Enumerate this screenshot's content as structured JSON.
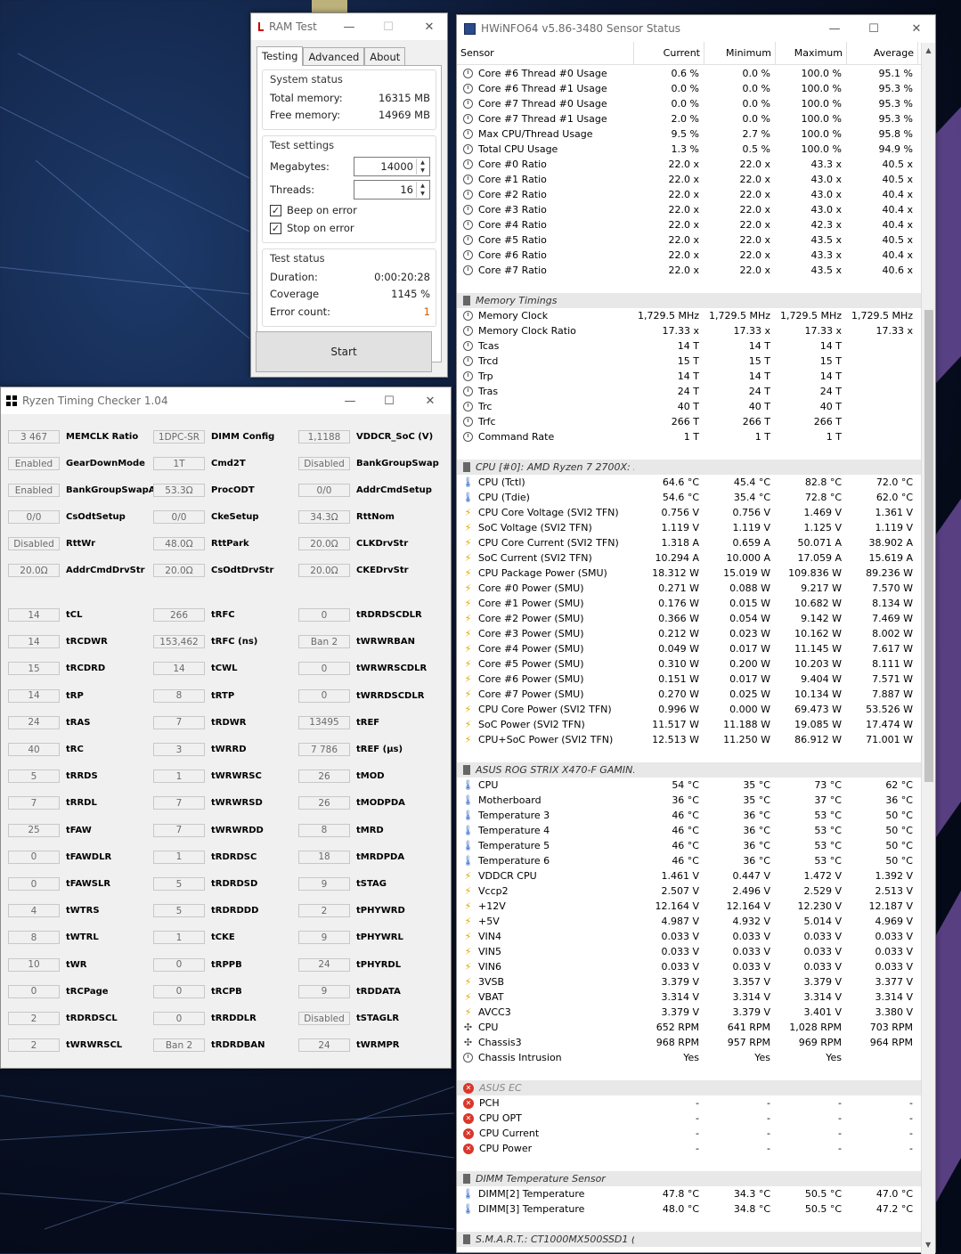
{
  "ram_test": {
    "title": "RAM Test",
    "tabs": [
      "Testing",
      "Advanced",
      "About"
    ],
    "system_status": {
      "title": "System status",
      "total_label": "Total memory:",
      "total_value": "16315 MB",
      "free_label": "Free memory:",
      "free_value": "14969 MB"
    },
    "test_settings": {
      "title": "Test settings",
      "megabytes_label": "Megabytes:",
      "megabytes_value": "14000",
      "threads_label": "Threads:",
      "threads_value": "16",
      "beep_label": "Beep on error",
      "stop_label": "Stop on error"
    },
    "test_status": {
      "title": "Test status",
      "duration_label": "Duration:",
      "duration_value": "0:00:20:28",
      "coverage_label": "Coverage",
      "coverage_value": "1145 %",
      "error_label": "Error count:",
      "error_value": "1"
    },
    "start_label": "Start"
  },
  "rtc": {
    "title": "Ryzen Timing Checker 1.04",
    "top": [
      [
        "3 467",
        "MEMCLK Ratio",
        "1DPC-SR",
        "DIMM Config",
        "1,1188",
        "VDDCR_SoC (V)"
      ],
      [
        "Enabled",
        "GearDownMode",
        "1T",
        "Cmd2T",
        "Disabled",
        "BankGroupSwap"
      ],
      [
        "Enabled",
        "BankGroupSwapAlt",
        "53.3Ω",
        "ProcODT",
        "0/0",
        "AddrCmdSetup"
      ],
      [
        "0/0",
        "CsOdtSetup",
        "0/0",
        "CkeSetup",
        "34.3Ω",
        "RttNom"
      ],
      [
        "Disabled",
        "RttWr",
        "48.0Ω",
        "RttPark",
        "20.0Ω",
        "CLKDrvStr"
      ],
      [
        "20.0Ω",
        "AddrCmdDrvStr",
        "20.0Ω",
        "CsOdtDrvStr",
        "20.0Ω",
        "CKEDrvStr"
      ]
    ],
    "bottom": [
      [
        "14",
        "tCL",
        "266",
        "tRFC",
        "0",
        "tRDRDSCDLR"
      ],
      [
        "14",
        "tRCDWR",
        "153,462",
        "tRFC (ns)",
        "Ban 2",
        "tWRWRBAN"
      ],
      [
        "15",
        "tRCDRD",
        "14",
        "tCWL",
        "0",
        "tWRWRSCDLR"
      ],
      [
        "14",
        "tRP",
        "8",
        "tRTP",
        "0",
        "tWRRDSCDLR"
      ],
      [
        "24",
        "tRAS",
        "7",
        "tRDWR",
        "13495",
        "tREF"
      ],
      [
        "40",
        "tRC",
        "3",
        "tWRRD",
        "7 786",
        "tREF (µs)"
      ],
      [
        "5",
        "tRRDS",
        "1",
        "tWRWRSC",
        "26",
        "tMOD"
      ],
      [
        "7",
        "tRRDL",
        "7",
        "tWRWRSD",
        "26",
        "tMODPDA"
      ],
      [
        "25",
        "tFAW",
        "7",
        "tWRWRDD",
        "8",
        "tMRD"
      ],
      [
        "0",
        "tFAWDLR",
        "1",
        "tRDRDSC",
        "18",
        "tMRDPDA"
      ],
      [
        "0",
        "tFAWSLR",
        "5",
        "tRDRDSD",
        "9",
        "tSTAG"
      ],
      [
        "4",
        "tWTRS",
        "5",
        "tRDRDDD",
        "2",
        "tPHYWRD"
      ],
      [
        "8",
        "tWTRL",
        "1",
        "tCKE",
        "9",
        "tPHYWRL"
      ],
      [
        "10",
        "tWR",
        "0",
        "tRPPB",
        "24",
        "tPHYRDL"
      ],
      [
        "0",
        "tRCPage",
        "0",
        "tRCPB",
        "9",
        "tRDDATA"
      ],
      [
        "2",
        "tRDRDSCL",
        "0",
        "tRRDDLR",
        "Disabled",
        "tSTAGLR"
      ],
      [
        "2",
        "tWRWRSCL",
        "Ban 2",
        "tRDRDBAN",
        "24",
        "tWRMPR"
      ]
    ]
  },
  "hwinfo": {
    "title": "HWiNFO64 v5.86-3480 Sensor Status",
    "headers": [
      "Sensor",
      "Current",
      "Minimum",
      "Maximum",
      "Average"
    ],
    "rows": [
      [
        "clock",
        "Core #6 Thread #0 Usage",
        "0.6 %",
        "0.0 %",
        "100.0 %",
        "95.1 %"
      ],
      [
        "clock",
        "Core #6 Thread #1 Usage",
        "0.0 %",
        "0.0 %",
        "100.0 %",
        "95.3 %"
      ],
      [
        "clock",
        "Core #7 Thread #0 Usage",
        "0.0 %",
        "0.0 %",
        "100.0 %",
        "95.3 %"
      ],
      [
        "clock",
        "Core #7 Thread #1 Usage",
        "2.0 %",
        "0.0 %",
        "100.0 %",
        "95.3 %"
      ],
      [
        "clock",
        "Max CPU/Thread Usage",
        "9.5 %",
        "2.7 %",
        "100.0 %",
        "95.8 %"
      ],
      [
        "clock",
        "Total CPU Usage",
        "1.3 %",
        "0.5 %",
        "100.0 %",
        "94.9 %"
      ],
      [
        "clock",
        "Core #0 Ratio",
        "22.0 x",
        "22.0 x",
        "43.3 x",
        "40.5 x"
      ],
      [
        "clock",
        "Core #1 Ratio",
        "22.0 x",
        "22.0 x",
        "43.0 x",
        "40.5 x"
      ],
      [
        "clock",
        "Core #2 Ratio",
        "22.0 x",
        "22.0 x",
        "43.0 x",
        "40.4 x"
      ],
      [
        "clock",
        "Core #3 Ratio",
        "22.0 x",
        "22.0 x",
        "43.0 x",
        "40.4 x"
      ],
      [
        "clock",
        "Core #4 Ratio",
        "22.0 x",
        "22.0 x",
        "42.3 x",
        "40.4 x"
      ],
      [
        "clock",
        "Core #5 Ratio",
        "22.0 x",
        "22.0 x",
        "43.5 x",
        "40.5 x"
      ],
      [
        "clock",
        "Core #6 Ratio",
        "22.0 x",
        "22.0 x",
        "43.3 x",
        "40.4 x"
      ],
      [
        "clock",
        "Core #7 Ratio",
        "22.0 x",
        "22.0 x",
        "43.5 x",
        "40.6 x"
      ],
      [
        "blank",
        "",
        "",
        "",
        "",
        ""
      ],
      [
        "group",
        "Memory Timings",
        "",
        "",
        "",
        ""
      ],
      [
        "clock",
        "Memory Clock",
        "1,729.5 MHz",
        "1,729.5 MHz",
        "1,729.5 MHz",
        "1,729.5 MHz"
      ],
      [
        "clock",
        "Memory Clock Ratio",
        "17.33 x",
        "17.33 x",
        "17.33 x",
        "17.33 x"
      ],
      [
        "clock",
        "Tcas",
        "14 T",
        "14 T",
        "14 T",
        ""
      ],
      [
        "clock",
        "Trcd",
        "15 T",
        "15 T",
        "15 T",
        ""
      ],
      [
        "clock",
        "Trp",
        "14 T",
        "14 T",
        "14 T",
        ""
      ],
      [
        "clock",
        "Tras",
        "24 T",
        "24 T",
        "24 T",
        ""
      ],
      [
        "clock",
        "Trc",
        "40 T",
        "40 T",
        "40 T",
        ""
      ],
      [
        "clock",
        "Trfc",
        "266 T",
        "266 T",
        "266 T",
        ""
      ],
      [
        "clock",
        "Command Rate",
        "1 T",
        "1 T",
        "1 T",
        ""
      ],
      [
        "blank",
        "",
        "",
        "",
        "",
        ""
      ],
      [
        "group",
        "CPU [#0]: AMD Ryzen 7 2700X: E...",
        "",
        "",
        "",
        ""
      ],
      [
        "therm",
        "CPU (Tctl)",
        "64.6 °C",
        "45.4 °C",
        "82.8 °C",
        "72.0 °C"
      ],
      [
        "therm",
        "CPU (Tdie)",
        "54.6 °C",
        "35.4 °C",
        "72.8 °C",
        "62.0 °C"
      ],
      [
        "bolt",
        "CPU Core Voltage (SVI2 TFN)",
        "0.756 V",
        "0.756 V",
        "1.469 V",
        "1.361 V"
      ],
      [
        "bolt",
        "SoC Voltage (SVI2 TFN)",
        "1.119 V",
        "1.119 V",
        "1.125 V",
        "1.119 V"
      ],
      [
        "bolt",
        "CPU Core Current (SVI2 TFN)",
        "1.318 A",
        "0.659 A",
        "50.071 A",
        "38.902 A"
      ],
      [
        "bolt",
        "SoC Current (SVI2 TFN)",
        "10.294 A",
        "10.000 A",
        "17.059 A",
        "15.619 A"
      ],
      [
        "bolt",
        "CPU Package Power (SMU)",
        "18.312 W",
        "15.019 W",
        "109.836 W",
        "89.236 W"
      ],
      [
        "bolt",
        "Core #0 Power (SMU)",
        "0.271 W",
        "0.088 W",
        "9.217 W",
        "7.570 W"
      ],
      [
        "bolt",
        "Core #1 Power (SMU)",
        "0.176 W",
        "0.015 W",
        "10.682 W",
        "8.134 W"
      ],
      [
        "bolt",
        "Core #2 Power (SMU)",
        "0.366 W",
        "0.054 W",
        "9.142 W",
        "7.469 W"
      ],
      [
        "bolt",
        "Core #3 Power (SMU)",
        "0.212 W",
        "0.023 W",
        "10.162 W",
        "8.002 W"
      ],
      [
        "bolt",
        "Core #4 Power (SMU)",
        "0.049 W",
        "0.017 W",
        "11.145 W",
        "7.617 W"
      ],
      [
        "bolt",
        "Core #5 Power (SMU)",
        "0.310 W",
        "0.200 W",
        "10.203 W",
        "8.111 W"
      ],
      [
        "bolt",
        "Core #6 Power (SMU)",
        "0.151 W",
        "0.017 W",
        "9.404 W",
        "7.571 W"
      ],
      [
        "bolt",
        "Core #7 Power (SMU)",
        "0.270 W",
        "0.025 W",
        "10.134 W",
        "7.887 W"
      ],
      [
        "bolt",
        "CPU Core Power (SVI2 TFN)",
        "0.996 W",
        "0.000 W",
        "69.473 W",
        "53.526 W"
      ],
      [
        "bolt",
        "SoC Power (SVI2 TFN)",
        "11.517 W",
        "11.188 W",
        "19.085 W",
        "17.474 W"
      ],
      [
        "bolt",
        "CPU+SoC Power (SVI2 TFN)",
        "12.513 W",
        "11.250 W",
        "86.912 W",
        "71.001 W"
      ],
      [
        "blank",
        "",
        "",
        "",
        "",
        ""
      ],
      [
        "group",
        "ASUS ROG STRIX X470-F GAMIN...",
        "",
        "",
        "",
        ""
      ],
      [
        "therm",
        "CPU",
        "54 °C",
        "35 °C",
        "73 °C",
        "62 °C"
      ],
      [
        "therm",
        "Motherboard",
        "36 °C",
        "35 °C",
        "37 °C",
        "36 °C"
      ],
      [
        "therm",
        "Temperature 3",
        "46 °C",
        "36 °C",
        "53 °C",
        "50 °C"
      ],
      [
        "therm",
        "Temperature 4",
        "46 °C",
        "36 °C",
        "53 °C",
        "50 °C"
      ],
      [
        "therm",
        "Temperature 5",
        "46 °C",
        "36 °C",
        "53 °C",
        "50 °C"
      ],
      [
        "therm",
        "Temperature 6",
        "46 °C",
        "36 °C",
        "53 °C",
        "50 °C"
      ],
      [
        "bolt",
        "VDDCR CPU",
        "1.461 V",
        "0.447 V",
        "1.472 V",
        "1.392 V"
      ],
      [
        "bolt",
        "Vccp2",
        "2.507 V",
        "2.496 V",
        "2.529 V",
        "2.513 V"
      ],
      [
        "bolt",
        "+12V",
        "12.164 V",
        "12.164 V",
        "12.230 V",
        "12.187 V"
      ],
      [
        "bolt",
        "+5V",
        "4.987 V",
        "4.932 V",
        "5.014 V",
        "4.969 V"
      ],
      [
        "bolt",
        "VIN4",
        "0.033 V",
        "0.033 V",
        "0.033 V",
        "0.033 V"
      ],
      [
        "bolt",
        "VIN5",
        "0.033 V",
        "0.033 V",
        "0.033 V",
        "0.033 V"
      ],
      [
        "bolt",
        "VIN6",
        "0.033 V",
        "0.033 V",
        "0.033 V",
        "0.033 V"
      ],
      [
        "bolt",
        "3VSB",
        "3.379 V",
        "3.357 V",
        "3.379 V",
        "3.377 V"
      ],
      [
        "bolt",
        "VBAT",
        "3.314 V",
        "3.314 V",
        "3.314 V",
        "3.314 V"
      ],
      [
        "bolt",
        "AVCC3",
        "3.379 V",
        "3.379 V",
        "3.401 V",
        "3.380 V"
      ],
      [
        "fan",
        "CPU",
        "652 RPM",
        "641 RPM",
        "1,028 RPM",
        "703 RPM"
      ],
      [
        "fan",
        "Chassis3",
        "968 RPM",
        "957 RPM",
        "969 RPM",
        "964 RPM"
      ],
      [
        "clock",
        "Chassis Intrusion",
        "Yes",
        "Yes",
        "Yes",
        ""
      ],
      [
        "blank",
        "",
        "",
        "",
        "",
        ""
      ],
      [
        "errgroup",
        "ASUS EC",
        "",
        "",
        "",
        ""
      ],
      [
        "err",
        "PCH",
        "-",
        "-",
        "-",
        "-"
      ],
      [
        "err",
        "CPU OPT",
        "-",
        "-",
        "-",
        "-"
      ],
      [
        "err",
        "CPU Current",
        "-",
        "-",
        "-",
        "-"
      ],
      [
        "err",
        "CPU Power",
        "-",
        "-",
        "-",
        "-"
      ],
      [
        "blank",
        "",
        "",
        "",
        "",
        ""
      ],
      [
        "group",
        "DIMM Temperature Sensor",
        "",
        "",
        "",
        ""
      ],
      [
        "therm",
        "DIMM[2] Temperature",
        "47.8 °C",
        "34.3 °C",
        "50.5 °C",
        "47.0 °C"
      ],
      [
        "therm",
        "DIMM[3] Temperature",
        "48.0 °C",
        "34.8 °C",
        "50.5 °C",
        "47.2 °C"
      ],
      [
        "blank",
        "",
        "",
        "",
        "",
        ""
      ],
      [
        "group",
        "S.M.A.R.T.: CT1000MX500SSD1 (",
        "",
        "",
        "",
        ""
      ]
    ]
  }
}
